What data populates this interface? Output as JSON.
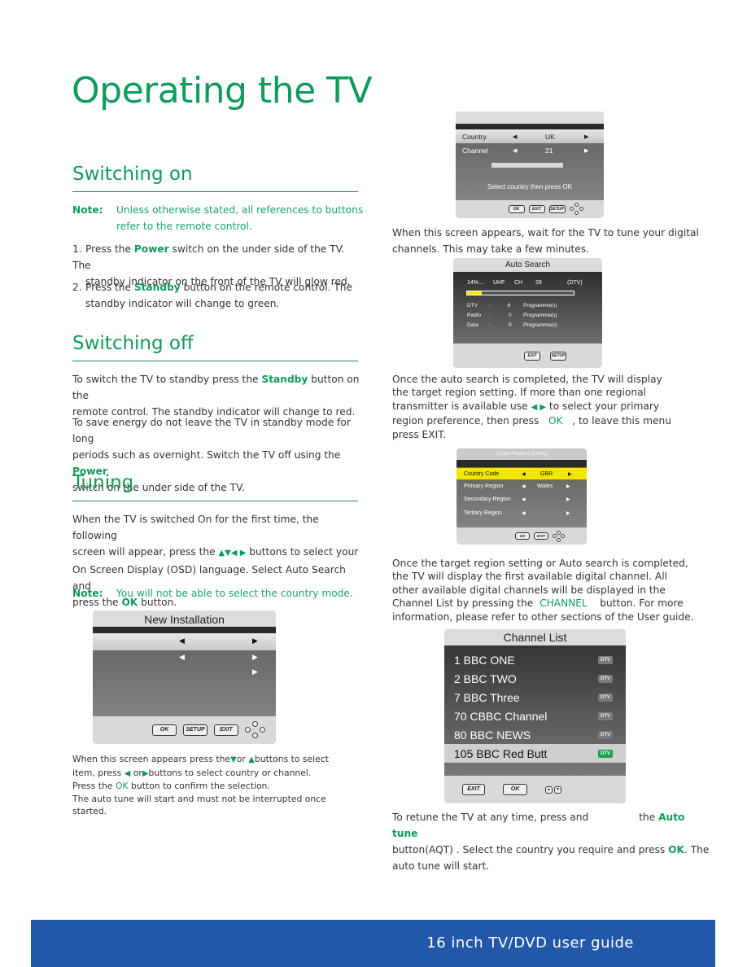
{
  "page": {
    "title": "Operating the TV",
    "footer": "16 inch TV/DVD user guide",
    "accent_color": "#0f9b5b",
    "footer_color": "#2258a8"
  },
  "switching_on": {
    "heading": "Switching on",
    "note_label": "Note:",
    "note_line1": "Unless otherwise stated, all references to buttons",
    "note_line2": "refer to the remote control.",
    "step1_num": "1.",
    "step1_pre": "Press the ",
    "step1_key": "Power",
    "step1_post": " switch on the under  side of the TV. The",
    "step1_line2": "standby indicator on the front of the TV will glow red.",
    "step2_num": "2.",
    "step2_pre": "Press the ",
    "step2_key": "Standby",
    "step2_post": " button on the remote control. The",
    "step2_line2": "standby indicator will change to green."
  },
  "switching_off": {
    "heading": "Switching off",
    "p1_pre": "To switch the TV to standby press the ",
    "p1_key": "Standby",
    "p1_post": " button on the",
    "p1_line2": "remote control. The standby indicator will change to red.",
    "p2_line1": "To save energy do not leave the TV in standby mode for long",
    "p2_pre": "periods such as overnight. Switch the TV off using the ",
    "p2_key": "Power",
    "p2_line3": "switch on the under side of the TV."
  },
  "tuning": {
    "heading": "Tuning",
    "p1_line1": "When the TV is switched On for the first time, the following",
    "p1_pre": "screen will appear, press the ",
    "p1_arrows": "▲▼◀ ▶",
    "p1_post": " buttons to select your",
    "p1_line3": "On Screen Display (OSD) language. Select Auto Search and",
    "p1_line4_pre": "press the ",
    "p1_line4_key": "OK",
    "p1_line4_post": " button.",
    "note_label": "Note:",
    "note_text": "You will not be able to select the country mode.",
    "caption_l1_pre": "When this screen appears press the",
    "caption_l1_down": "▼",
    "caption_l1_mid": "or ",
    "caption_l1_up": "▲",
    "caption_l1_post": "buttons to select",
    "caption_l2_pre": " item, press ",
    "caption_l2_left": "◀",
    "caption_l2_mid": " or",
    "caption_l2_right": "▶",
    "caption_l2_post": "buttons to select country or channel.",
    "caption_l3_pre": "Press the  ",
    "caption_l3_key": "OK",
    "caption_l3_post": " button to confirm the selection.",
    "caption_l4": "The auto tune will start and must not be interrupted once",
    "caption_l5": " started."
  },
  "osd_new_installation": {
    "title": "New Installation",
    "buttons": [
      "OK",
      "SETUP",
      "EXIT"
    ]
  },
  "osd_country": {
    "rows": [
      {
        "label": "Country",
        "value": "UK"
      },
      {
        "label": "Channel",
        "value": "21"
      }
    ],
    "message": "Select country then press OK",
    "buttons": [
      "OK",
      "EXIT",
      "SETUP"
    ]
  },
  "right_col": {
    "p1_line1": "When this screen appears, wait for the TV to tune your digital",
    "p1_line2": "channels. This may take a few minutes.",
    "p2_line1": "Once the auto search is completed, the TV will display",
    "p2_line2": "the target region setting. If more than one regional",
    "p2_line3_pre": "transmitter is available use ",
    "p2_line3_arrows": "◀ ▶",
    "p2_line3_post": " to select your primary",
    "p2_line4_pre": "region preference, then press   ",
    "p2_line4_key": "OK",
    "p2_line4_post": "   , to leave this menu",
    "p2_line5": "press EXIT.",
    "p3_line1": "Once the target region setting or Auto search is completed,",
    "p3_line2": "the TV will display the first available digital channel. All",
    "p3_line3": "other available digital channels will be displayed in the",
    "p3_line4_pre": "Channel List by pressing the  ",
    "p3_line4_key": "CHANNEL",
    "p3_line4_post": "    button. For more",
    "p3_line5": "information, please refer to other sections of the User guide.",
    "p4_line1_pre": "To retune the TV at any time, press and                the ",
    "p4_line1_key": "Auto tune",
    "p4_line2_pre": "button(AQT) . Select the country you require and press ",
    "p4_line2_key": "OK",
    "p4_line2_post": ". The",
    "p4_line3": "auto tune will start."
  },
  "osd_auto_search": {
    "title": "Auto Search",
    "progress_label": "14%....",
    "band": "UHF",
    "ch_label": "CH",
    "channel": "28",
    "mode": "(DTV)",
    "progress": 0.14,
    "rows": [
      {
        "label": "DTV",
        "sep": ":",
        "count": "6",
        "unit": "Programme(s)"
      },
      {
        "label": "Radio",
        "sep": ":",
        "count": "0",
        "unit": "Programme(s)"
      },
      {
        "label": "Data",
        "sep": ":",
        "count": "0",
        "unit": "Programme(s)"
      }
    ],
    "buttons": [
      "EXIT",
      "SETUP"
    ]
  },
  "osd_target_region": {
    "title": "Target Region Setting",
    "rows": [
      {
        "label": "Country Code",
        "value": "GBR",
        "selected": true
      },
      {
        "label": "Primary Region",
        "value": "Wales",
        "selected": false
      },
      {
        "label": "Secondary Region",
        "value": "",
        "selected": false
      },
      {
        "label": "Tertiary Region",
        "value": "",
        "selected": false
      }
    ],
    "buttons": [
      "OK",
      "EXIT"
    ],
    "highlight_color": "#f2e600"
  },
  "osd_channel_list": {
    "title": "Channel List",
    "channels": [
      {
        "name": "1 BBC ONE",
        "badge": "DTV"
      },
      {
        "name": "2 BBC TWO",
        "badge": "DTV"
      },
      {
        "name": "7 BBC Three",
        "badge": "DTV"
      },
      {
        "name": "70 CBBC Channel",
        "badge": "DTV"
      },
      {
        "name": "80 BBC NEWS",
        "badge": "DTV"
      },
      {
        "name": "105 BBC Red Butt",
        "badge": "DTV"
      }
    ],
    "selected_index": 5,
    "buttons": [
      "EXIT",
      "OK"
    ]
  }
}
